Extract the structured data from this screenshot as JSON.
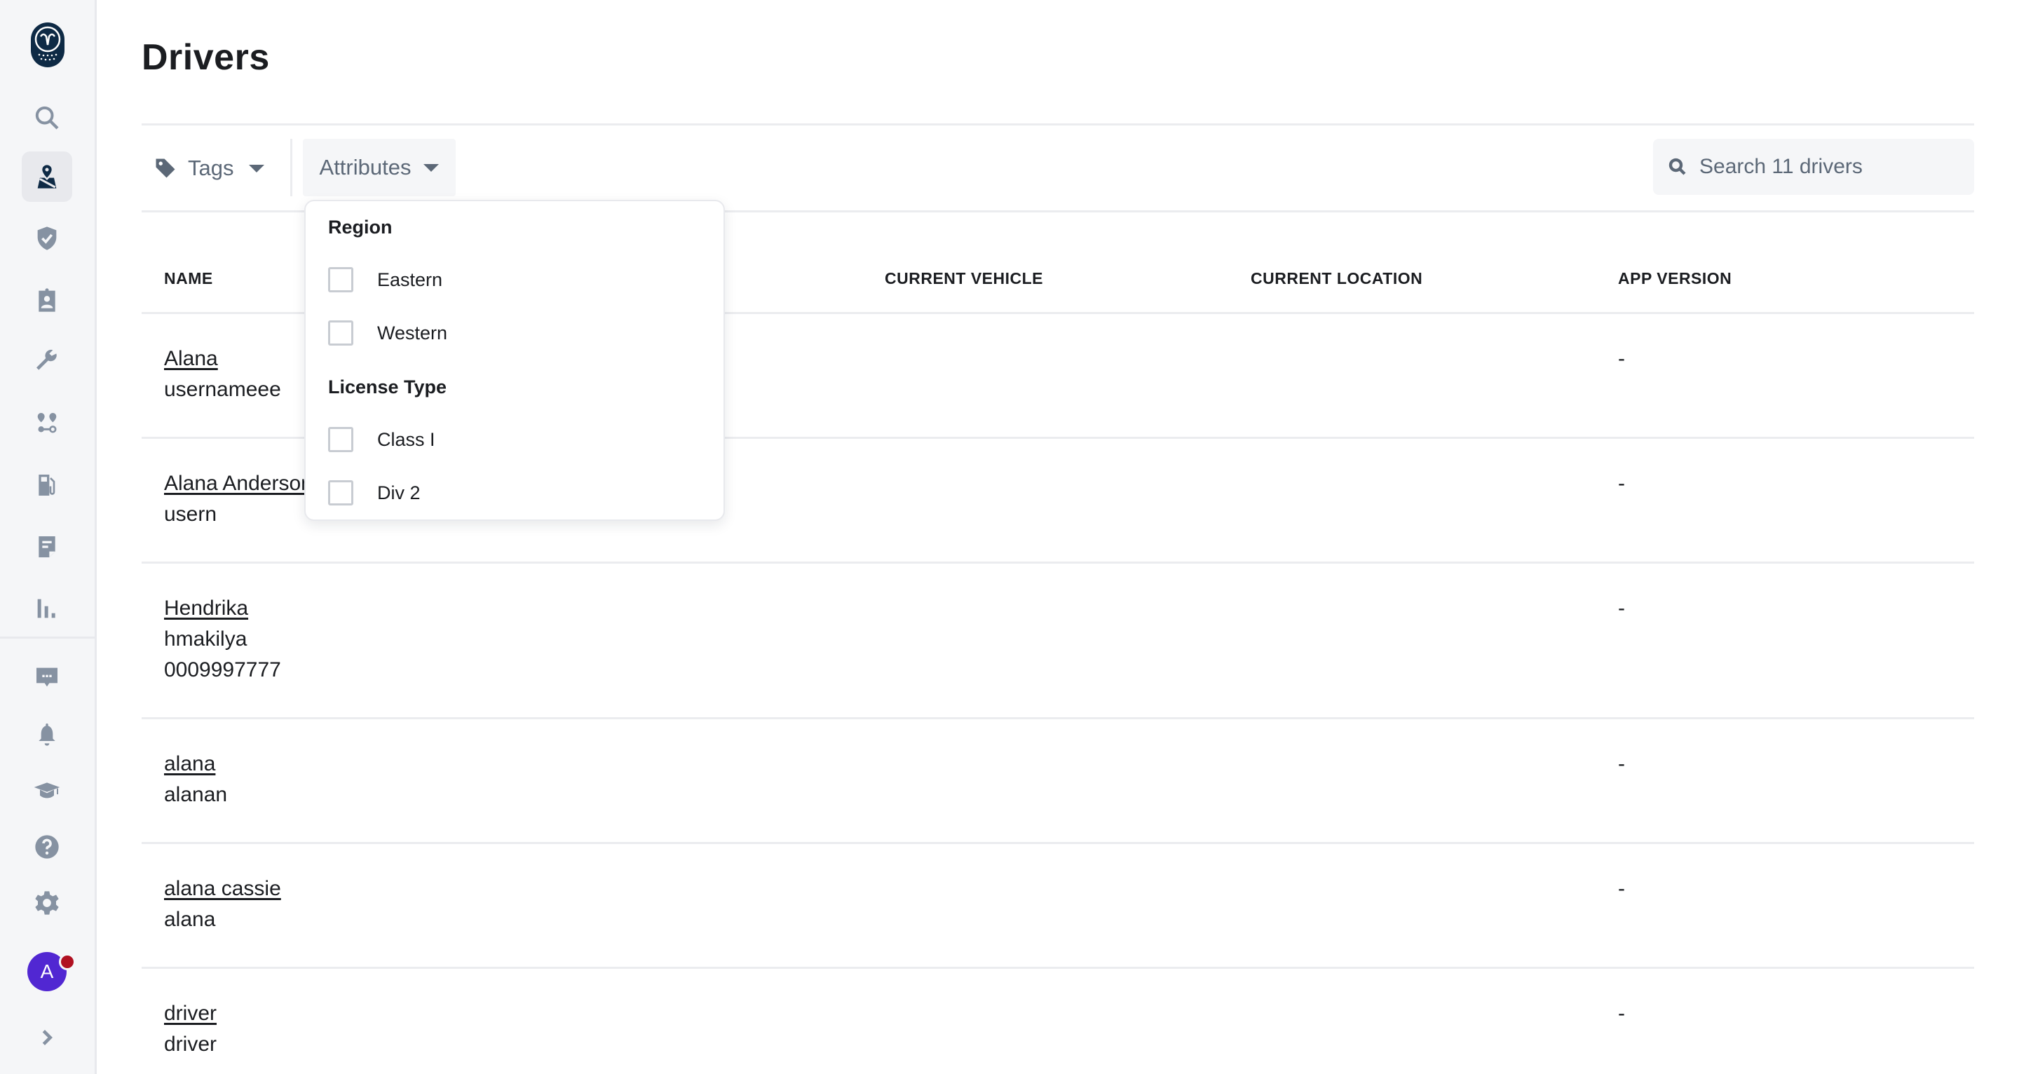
{
  "sidebar": {
    "logo": "owl-logo",
    "items": [
      {
        "name": "search",
        "icon": "search-icon",
        "active": false
      },
      {
        "name": "drivers",
        "icon": "driver-map-icon",
        "active": true
      },
      {
        "name": "safety",
        "icon": "shield-check-icon",
        "active": false
      },
      {
        "name": "compliance",
        "icon": "badge-icon",
        "active": false
      },
      {
        "name": "maintenance",
        "icon": "wrench-icon",
        "active": false
      },
      {
        "name": "routes",
        "icon": "route-icon",
        "active": false
      },
      {
        "name": "fuel",
        "icon": "fuel-icon",
        "active": false
      },
      {
        "name": "documents",
        "icon": "document-icon",
        "active": false
      },
      {
        "name": "reports",
        "icon": "bar-chart-icon",
        "active": false
      },
      {
        "name": "messages",
        "icon": "message-icon",
        "active": false
      },
      {
        "name": "alerts",
        "icon": "bell-icon",
        "active": false
      },
      {
        "name": "training",
        "icon": "graduation-cap-icon",
        "active": false
      },
      {
        "name": "help",
        "icon": "help-icon",
        "active": false
      },
      {
        "name": "settings",
        "icon": "gear-icon",
        "active": false
      }
    ],
    "avatar_initial": "A",
    "notification_color": "#b01021",
    "avatar_color": "#5127d2"
  },
  "page": {
    "title": "Drivers"
  },
  "filters": {
    "tags_label": "Tags",
    "attributes_label": "Attributes"
  },
  "search": {
    "placeholder": "Search 11 drivers",
    "value": ""
  },
  "table": {
    "columns": [
      "NAME",
      "CURRENT VEHICLE",
      "CURRENT LOCATION",
      "APP VERSION"
    ],
    "rows": [
      {
        "name": "Alana",
        "lines": [
          "usernameee"
        ],
        "app_version": "-"
      },
      {
        "name": "Alana Anderson",
        "lines": [
          "usern"
        ],
        "app_version": "-"
      },
      {
        "name": "Hendrika",
        "lines": [
          "hmakilya",
          "0009997777"
        ],
        "app_version": "-"
      },
      {
        "name": "alana",
        "lines": [
          "alanan"
        ],
        "app_version": "-"
      },
      {
        "name": "alana cassie",
        "lines": [
          "alana"
        ],
        "app_version": "-"
      },
      {
        "name": "driver",
        "lines": [
          "driver"
        ],
        "app_version": "-"
      }
    ]
  },
  "attributes_dropdown": {
    "groups": [
      {
        "heading": "Region",
        "options": [
          {
            "label": "Eastern",
            "checked": false
          },
          {
            "label": "Western",
            "checked": false
          }
        ]
      },
      {
        "heading": "License Type",
        "options": [
          {
            "label": "Class I",
            "checked": false
          },
          {
            "label": "Div 2",
            "checked": false
          }
        ]
      }
    ]
  }
}
